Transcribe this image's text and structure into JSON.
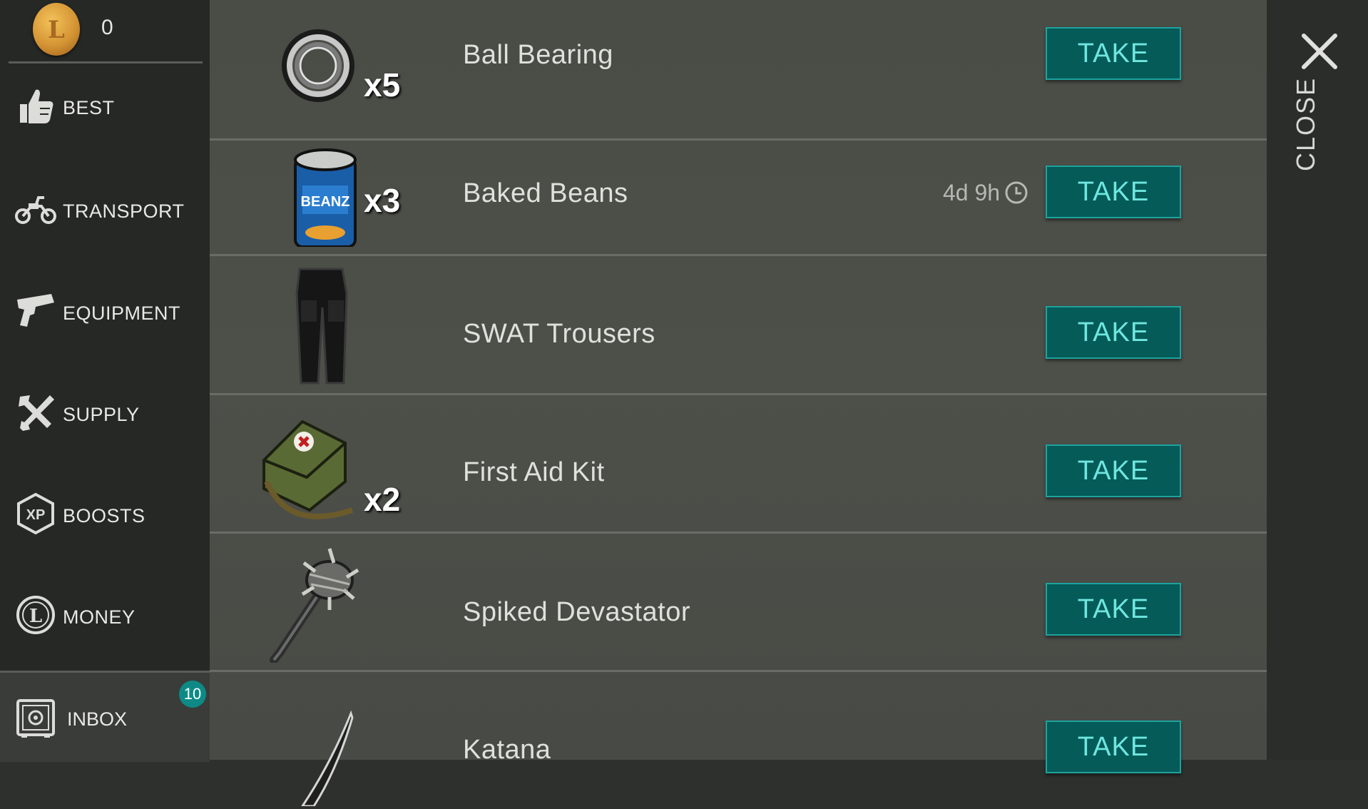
{
  "currency": {
    "coins": "0",
    "coin_symbol": "L"
  },
  "sidebar": {
    "items": [
      {
        "label": "BEST",
        "icon": "thumbs-up-icon"
      },
      {
        "label": "TRANSPORT",
        "icon": "motorcycle-icon"
      },
      {
        "label": "EQUIPMENT",
        "icon": "pistol-icon"
      },
      {
        "label": "SUPPLY",
        "icon": "crossed-tools-icon"
      },
      {
        "label": "BOOSTS",
        "icon": "xp-hexagon-icon",
        "icon_text": "XP"
      },
      {
        "label": "MONEY",
        "icon": "coin-outline-icon",
        "icon_text": "L"
      }
    ],
    "inbox": {
      "label": "INBOX",
      "badge": "10",
      "icon": "safe-icon"
    }
  },
  "items": [
    {
      "name": "Ball Bearing",
      "qty": "x5",
      "timer": "",
      "action": "TAKE",
      "icon": "ball-bearing-icon"
    },
    {
      "name": "Baked Beans",
      "qty": "x3",
      "timer": "4d 9h",
      "action": "TAKE",
      "icon": "bean-can-icon",
      "can_label": "BEANZ"
    },
    {
      "name": "SWAT Trousers",
      "qty": "",
      "timer": "",
      "action": "TAKE",
      "icon": "trousers-icon"
    },
    {
      "name": "First Aid Kit",
      "qty": "x2",
      "timer": "",
      "action": "TAKE",
      "icon": "first-aid-bag-icon"
    },
    {
      "name": "Spiked Devastator",
      "qty": "",
      "timer": "",
      "action": "TAKE",
      "icon": "spiked-mace-icon"
    },
    {
      "name": "Katana",
      "qty": "",
      "timer": "",
      "action": "TAKE",
      "icon": "katana-icon"
    }
  ],
  "close": {
    "label": "CLOSE"
  },
  "colors": {
    "accent": "#045b58",
    "accent_border": "#1da39e",
    "button_text": "#6fe6df",
    "badge": "#0d8a86",
    "sidebar_bg": "#262826",
    "list_bg": "#4b4d47"
  }
}
